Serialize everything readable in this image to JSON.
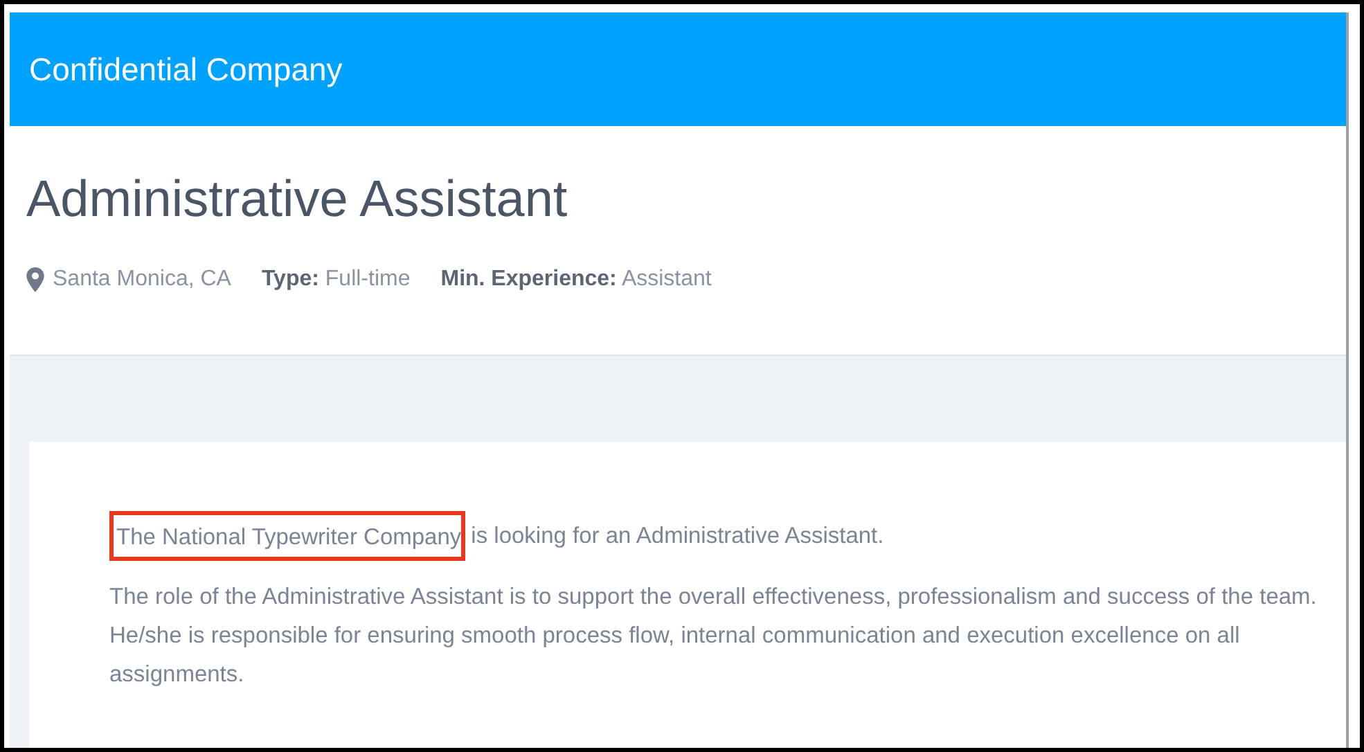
{
  "header": {
    "company": "Confidential Company"
  },
  "job": {
    "title": "Administrative Assistant",
    "location": "Santa Monica, CA",
    "meta": [
      {
        "label": "Type:",
        "value": "Full-time"
      },
      {
        "label": "Min. Experience:",
        "value": "Assistant"
      }
    ]
  },
  "description": {
    "intro": {
      "highlighted": "The National Typewriter Company",
      "rest": "is looking for an Administrative Assistant."
    },
    "paragraphs": [
      "The role of the Administrative Assistant is to support the overall effectiveness, professionalism and success of the team. He/she is responsible for ensuring smooth process flow, internal communication and execution excellence on all assignments."
    ]
  }
}
